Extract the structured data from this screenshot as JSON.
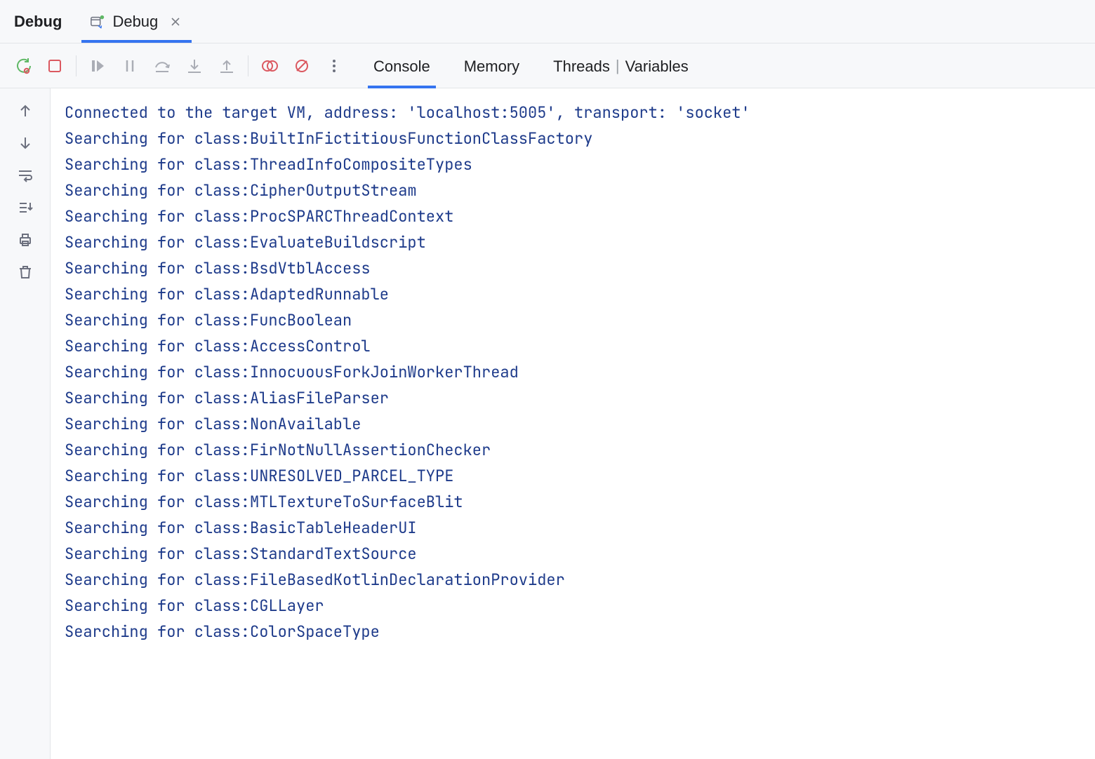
{
  "header": {
    "title": "Debug",
    "tab": {
      "label": "Debug"
    }
  },
  "views": {
    "console": "Console",
    "memory": "Memory",
    "threads": "Threads",
    "variables": "Variables"
  },
  "console_lines": [
    "Connected to the target VM, address: 'localhost:5005', transport: 'socket'",
    "Searching for class:BuiltInFictitiousFunctionClassFactory",
    "Searching for class:ThreadInfoCompositeTypes",
    "Searching for class:CipherOutputStream",
    "Searching for class:ProcSPARCThreadContext",
    "Searching for class:EvaluateBuildscript",
    "Searching for class:BsdVtblAccess",
    "Searching for class:AdaptedRunnable",
    "Searching for class:FuncBoolean",
    "Searching for class:AccessControl",
    "Searching for class:InnocuousForkJoinWorkerThread",
    "Searching for class:AliasFileParser",
    "Searching for class:NonAvailable",
    "Searching for class:FirNotNullAssertionChecker",
    "Searching for class:UNRESOLVED_PARCEL_TYPE",
    "Searching for class:MTLTextureToSurfaceBlit",
    "Searching for class:BasicTableHeaderUI",
    "Searching for class:StandardTextSource",
    "Searching for class:FileBasedKotlinDeclarationProvider",
    "Searching for class:CGLLayer",
    "Searching for class:ColorSpaceType"
  ]
}
